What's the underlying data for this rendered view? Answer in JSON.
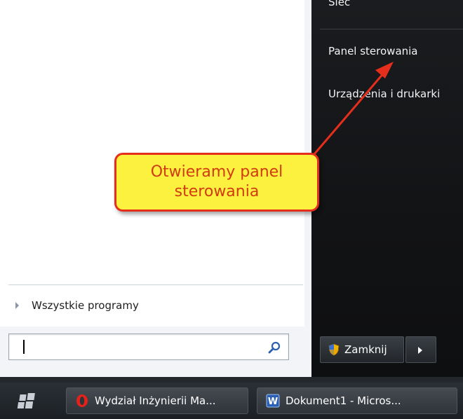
{
  "start_menu": {
    "all_programs_label": "Wszystkie programy",
    "search": {
      "value": "",
      "placeholder": ""
    },
    "right_items": {
      "network": "Sieć",
      "control_panel": "Panel sterowania",
      "devices_printers": "Urządzenia i drukarki"
    },
    "shutdown_label": "Zamknij"
  },
  "callout": {
    "text": "Otwieramy panel sterowania"
  },
  "taskbar": {
    "items": [
      {
        "label": "Wydział Inżynierii Ma...",
        "icon": "opera-icon"
      },
      {
        "label": "Dokument1 - Micros...",
        "icon": "word-icon"
      }
    ]
  },
  "colors": {
    "callout_fill": "#fbf13e",
    "callout_border": "#e52e1b",
    "callout_text": "#d23b12",
    "arrow": "#e52e1b"
  }
}
